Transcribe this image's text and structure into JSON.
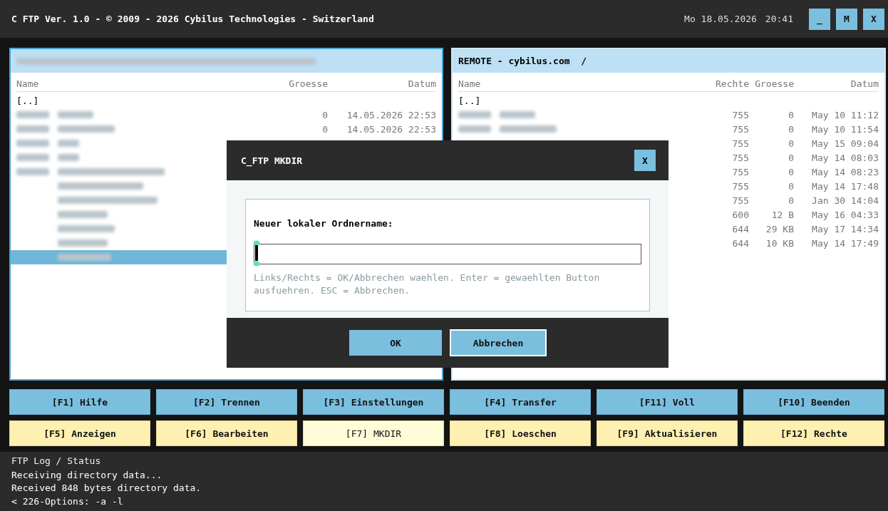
{
  "window": {
    "title": "C FTP Ver. 1.0 - © 2009 - 2026 Cybilus Technologies - Switzerland",
    "date": "Mo 18.05.2026",
    "time": "20:41",
    "controls": [
      "_",
      "M",
      "X"
    ]
  },
  "local_pane": {
    "active": true,
    "header_redacted": true,
    "columns": [
      "Name",
      "Groesse",
      "Datum"
    ],
    "rows": [
      {
        "kind": "parent",
        "name": "[..]",
        "selected": false
      },
      {
        "kind": "redacted",
        "dir": true,
        "size": "0",
        "date": "14.05.2026 22:53",
        "selected": false
      },
      {
        "kind": "redacted",
        "dir": true,
        "size": "0",
        "date": "14.05.2026 22:53",
        "selected": false
      },
      {
        "kind": "redacted",
        "dir": true,
        "selected": false
      },
      {
        "kind": "redacted",
        "dir": true,
        "selected": false
      },
      {
        "kind": "redacted",
        "dir": true,
        "selected": false
      },
      {
        "kind": "redacted",
        "dir": false,
        "selected": false
      },
      {
        "kind": "redacted",
        "dir": false,
        "selected": false
      },
      {
        "kind": "redacted",
        "dir": false,
        "selected": false
      },
      {
        "kind": "redacted",
        "dir": false,
        "selected": false
      },
      {
        "kind": "redacted",
        "dir": false,
        "selected": false
      },
      {
        "kind": "redacted",
        "dir": false,
        "selected": true
      }
    ]
  },
  "remote_pane": {
    "active": false,
    "header": "REMOTE - cybilus.com  /",
    "columns": [
      "Name",
      "Rechte",
      "Groesse",
      "Datum"
    ],
    "rows": [
      {
        "kind": "parent",
        "name": "[..]",
        "selected": false
      },
      {
        "kind": "redacted",
        "dir": true,
        "rights": "755",
        "size": "0",
        "date": "May 10 11:12",
        "selected": false
      },
      {
        "kind": "redacted",
        "dir": true,
        "rights": "755",
        "size": "0",
        "date": "May 10 11:54",
        "selected": false
      },
      {
        "kind": "covered",
        "rights": "755",
        "size": "0",
        "date": "May 15 09:04",
        "selected": false
      },
      {
        "kind": "covered",
        "rights": "755",
        "size": "0",
        "date": "May 14 08:03",
        "selected": false
      },
      {
        "kind": "covered",
        "rights": "755",
        "size": "0",
        "date": "May 14 08:23",
        "selected": false
      },
      {
        "kind": "covered",
        "rights": "755",
        "size": "0",
        "date": "May 14 17:48",
        "selected": false
      },
      {
        "kind": "covered",
        "rights": "755",
        "size": "0",
        "date": "Jan 30 14:04",
        "selected": false
      },
      {
        "kind": "covered",
        "rights": "600",
        "size": "12 B",
        "date": "May 16 04:33",
        "selected": false
      },
      {
        "kind": "covered",
        "rights": "644",
        "size": "29 KB",
        "date": "May 17 14:34",
        "selected": false
      },
      {
        "kind": "covered",
        "rights": "644",
        "size": "10 KB",
        "date": "May 14 17:49",
        "selected": false
      }
    ]
  },
  "dialog": {
    "title": "C_FTP MKDIR",
    "close": "X",
    "label": "Neuer lokaler Ordnername:",
    "focused": true,
    "hint": "Links/Rechts = OK/Abbrechen waehlen. Enter = gewaehlten Button ausfuehren. ESC = Abbrechen.",
    "buttons": [
      {
        "label": "OK",
        "selected": false
      },
      {
        "label": "Abbrechen",
        "selected": true
      }
    ]
  },
  "function_keys": {
    "row_1": [
      {
        "label": "[F1] Hilfe",
        "selected": false
      },
      {
        "label": "[F2] Trennen",
        "selected": false
      },
      {
        "label": "[F3] Einstellungen",
        "selected": false
      },
      {
        "label": "[F4] Transfer",
        "selected": false
      },
      {
        "label": "[F11] Voll",
        "selected": false
      },
      {
        "label": "[F10] Beenden",
        "selected": false
      }
    ],
    "row_2": [
      {
        "label": "[F5] Anzeigen",
        "selected": false
      },
      {
        "label": "[F6] Bearbeiten",
        "selected": false
      },
      {
        "label": "[F7] MKDIR",
        "selected": true
      },
      {
        "label": "[F8] Loeschen",
        "selected": false
      },
      {
        "label": "[F9] Aktualisieren",
        "selected": false
      },
      {
        "label": "[F12] Rechte",
        "selected": false
      }
    ]
  },
  "log": {
    "title": "FTP Log / Status",
    "lines": [
      "Receiving directory data...",
      "Received 848 bytes directory data.",
      "< 226-Options: -a -l"
    ]
  }
}
